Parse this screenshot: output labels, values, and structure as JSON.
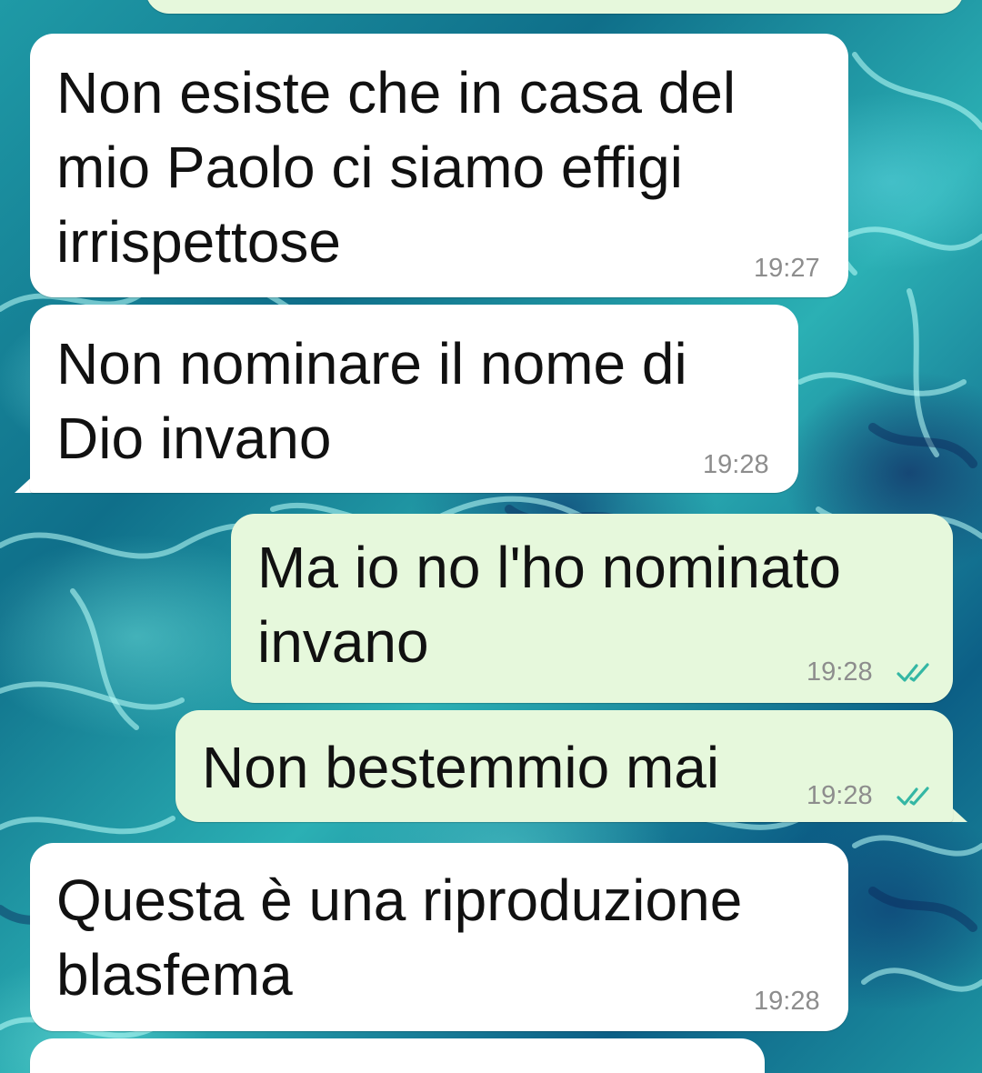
{
  "colors": {
    "incoming_bubble": "#ffffff",
    "outgoing_bubble": "#e6f8dc",
    "read_ticks": "#34b7a4",
    "timestamp": "#8d8d8d"
  },
  "messages": [
    {
      "direction": "incoming",
      "text": "Non esiste che in casa del\nmio Paolo ci siamo effigi\nirrispettose",
      "time": "19:27"
    },
    {
      "direction": "incoming",
      "text": "Non nominare il nome di\nDio invano",
      "time": "19:28"
    },
    {
      "direction": "outgoing",
      "text": "Ma io no l'ho nominato\ninvano",
      "time": "19:28",
      "status_icon": "double-check-icon"
    },
    {
      "direction": "outgoing",
      "text": "Non bestemmio mai",
      "time": "19:28",
      "status_icon": "double-check-icon"
    },
    {
      "direction": "incoming",
      "text": "Questa è una riproduzione\nblasfema",
      "time": "19:28"
    }
  ]
}
